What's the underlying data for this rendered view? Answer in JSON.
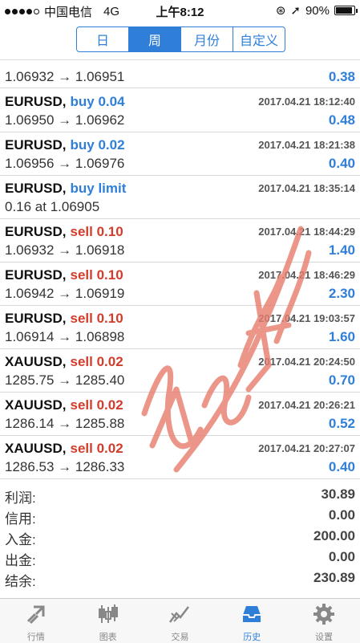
{
  "status_bar": {
    "carrier": "中国电信",
    "network": "4G",
    "time": "上午8:12",
    "battery_text": "90%",
    "battery_level": 0.9
  },
  "segments": [
    {
      "label": "日",
      "active": false
    },
    {
      "label": "周",
      "active": true
    },
    {
      "label": "月份",
      "active": false
    },
    {
      "label": "自定义",
      "active": false
    }
  ],
  "partial_row": {
    "prices": "1.06932 → 1.06951",
    "profit": "0.38"
  },
  "trades": [
    {
      "symbol": "EURUSD,",
      "side": "buy 0.04",
      "type": "buy",
      "time": "2017.04.21 18:12:40",
      "prices": "1.06950 → 1.06962",
      "profit": "0.48"
    },
    {
      "symbol": "EURUSD,",
      "side": "buy 0.02",
      "type": "buy",
      "time": "2017.04.21 18:21:38",
      "prices": "1.06956 → 1.06976",
      "profit": "0.40"
    },
    {
      "symbol": "EURUSD,",
      "side": "buy limit",
      "type": "buy",
      "time": "2017.04.21 18:35:14",
      "prices": "0.16 at 1.06905",
      "profit": ""
    },
    {
      "symbol": "EURUSD,",
      "side": "sell 0.10",
      "type": "sell",
      "time": "2017.04.21 18:44:29",
      "prices": "1.06932 → 1.06918",
      "profit": "1.40"
    },
    {
      "symbol": "EURUSD,",
      "side": "sell 0.10",
      "type": "sell",
      "time": "2017.04.21 18:46:29",
      "prices": "1.06942 → 1.06919",
      "profit": "2.30"
    },
    {
      "symbol": "EURUSD,",
      "side": "sell 0.10",
      "type": "sell",
      "time": "2017.04.21 19:03:57",
      "prices": "1.06914 → 1.06898",
      "profit": "1.60"
    },
    {
      "symbol": "XAUUSD,",
      "side": "sell 0.02",
      "type": "sell",
      "time": "2017.04.21 20:24:50",
      "prices": "1285.75 → 1285.40",
      "profit": "0.70"
    },
    {
      "symbol": "XAUUSD,",
      "side": "sell 0.02",
      "type": "sell",
      "time": "2017.04.21 20:26:21",
      "prices": "1286.14 → 1285.88",
      "profit": "0.52"
    },
    {
      "symbol": "XAUUSD,",
      "side": "sell 0.02",
      "type": "sell",
      "time": "2017.04.21 20:27:07",
      "prices": "1286.53 → 1286.33",
      "profit": "0.40"
    }
  ],
  "summary": [
    {
      "label": "利润:",
      "value": "30.89"
    },
    {
      "label": "信用:",
      "value": "0.00"
    },
    {
      "label": "入金:",
      "value": "200.00"
    },
    {
      "label": "出金:",
      "value": "0.00"
    },
    {
      "label": "结余:",
      "value": "230.89"
    }
  ],
  "tabbar": [
    {
      "label": "行情",
      "icon": "quotes-arrows-icon",
      "active": false
    },
    {
      "label": "图表",
      "icon": "candlestick-chart-icon",
      "active": false
    },
    {
      "label": "交易",
      "icon": "trade-chart-icon",
      "active": false
    },
    {
      "label": "历史",
      "icon": "history-inbox-icon",
      "active": true
    },
    {
      "label": "设置",
      "icon": "gear-icon",
      "active": false
    }
  ],
  "colors": {
    "accent": "#2f7fd9",
    "sell": "#d23c2a",
    "watermark": "#e87d6e"
  }
}
